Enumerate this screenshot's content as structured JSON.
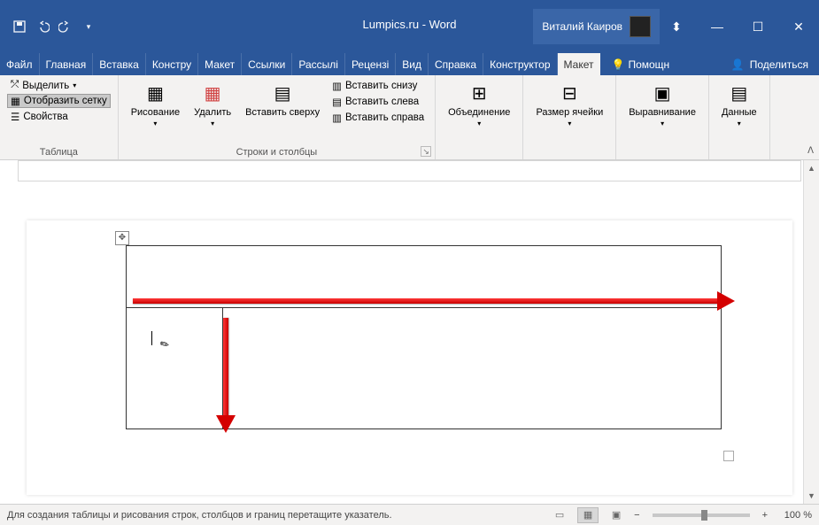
{
  "title": "Lumpics.ru  -  Word",
  "user": "Виталий Каиров",
  "tabs": {
    "file": "Файл",
    "home": "Главная",
    "insert": "Вставка",
    "design": "Констру",
    "layout": "Макет",
    "refs": "Ссылки",
    "mail": "Рассылі",
    "review": "Рецензі",
    "view": "Вид",
    "help": "Справка",
    "tt_design": "Конструктор",
    "tt_layout": "Макет",
    "help2": "Помощн",
    "share": "Поделиться"
  },
  "ribbon": {
    "g1": {
      "label": "Таблица",
      "select": "Выделить",
      "grid": "Отобразить сетку",
      "props": "Свойства"
    },
    "g2": {
      "draw": "Рисование",
      "erase": "Удалить",
      "insAbove": "Вставить сверху",
      "insBelow": "Вставить снизу",
      "insLeft": "Вставить слева",
      "insRight": "Вставить справа",
      "label": "Строки и столбцы"
    },
    "g3": {
      "merge": "Объединение"
    },
    "g4": {
      "cellsize": "Размер ячейки"
    },
    "g5": {
      "align": "Выравнивание"
    },
    "g6": {
      "data": "Данные"
    }
  },
  "status": {
    "msg": "Для создания таблицы и рисования строк, столбцов и границ перетащите указатель.",
    "zoom": "100 %"
  }
}
